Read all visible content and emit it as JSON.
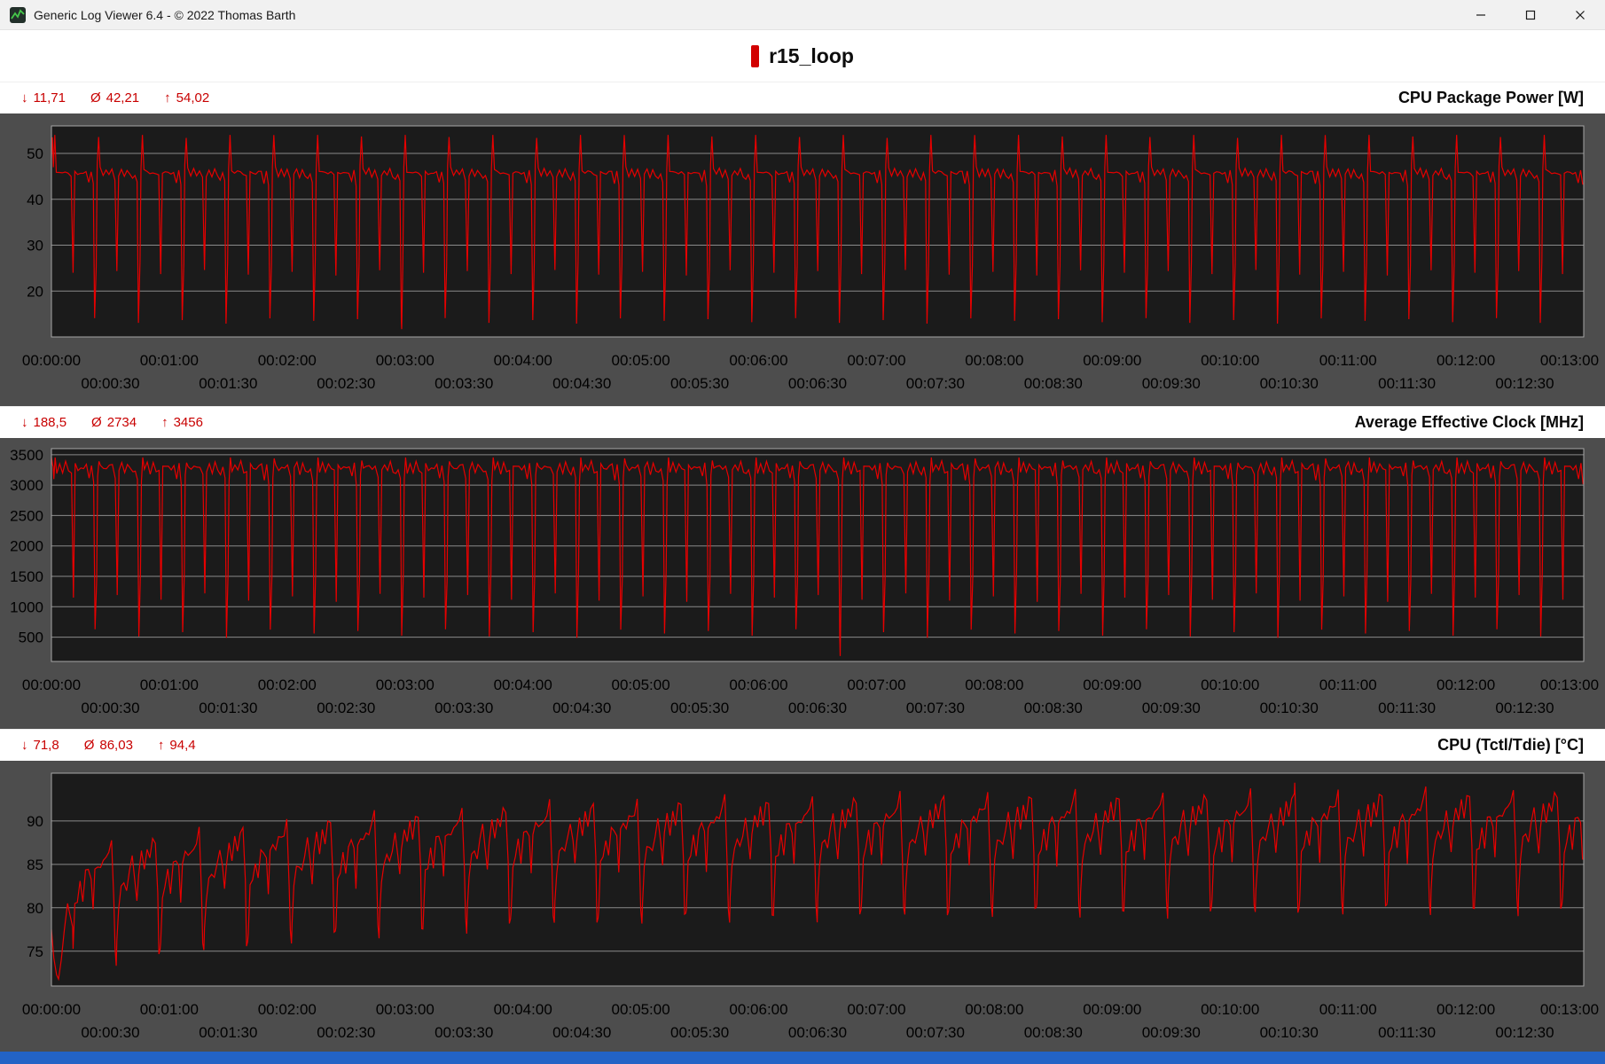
{
  "window": {
    "title": "Generic Log Viewer 6.4 - © 2022 Thomas Barth",
    "controls": [
      "minimize",
      "maximize",
      "close"
    ]
  },
  "header": {
    "title": "r15_loop"
  },
  "glyphs": {
    "min": "↓",
    "avg": "Ø",
    "max": "↑"
  },
  "sections": [
    {
      "title": "CPU Package Power [W]",
      "stats_min": "11,71",
      "stats_avg": "42,21",
      "stats_max": "54,02"
    },
    {
      "title": "Average Effective Clock [MHz]",
      "stats_min": "188,5",
      "stats_avg": "2734",
      "stats_max": "3456"
    },
    {
      "title": "CPU (Tctl/Tdie) [°C]",
      "stats_min": "71,8",
      "stats_avg": "86,03",
      "stats_max": "94,4"
    }
  ],
  "colors": {
    "line": "#e60000",
    "stats_text": "#c80000",
    "accent_bar": "#d20000",
    "block_bg": "#4d4d4d",
    "plot_bg": "#1b1b1b",
    "grid": "#8a8a8a",
    "plot_border": "#a6a6a6",
    "tick_text": "#000000",
    "status_bar": "#2363c5",
    "titlebar_bg": "#f1f1f1"
  },
  "chart_data": [
    {
      "type": "line",
      "title": "CPU Package Power [W]",
      "ylabel": "W",
      "stats": {
        "min": 11.71,
        "avg": 42.21,
        "max": 54.02
      },
      "duration_s": 780,
      "ylim": [
        10,
        56
      ],
      "yticks": [
        20,
        30,
        40,
        50
      ],
      "xticks_row1": [
        "00:00:00",
        "00:01:00",
        "00:02:00",
        "00:03:00",
        "00:04:00",
        "00:05:00",
        "00:06:00",
        "00:07:00",
        "00:08:00",
        "00:09:00",
        "00:10:00",
        "00:11:00",
        "00:12:00",
        "00:13:00"
      ],
      "xticks_row2": [
        "00:00:30",
        "00:01:30",
        "00:02:30",
        "00:03:30",
        "00:04:30",
        "00:05:30",
        "00:06:30",
        "00:07:30",
        "00:08:30",
        "00:09:30",
        "00:10:30",
        "00:11:30",
        "00:12:30"
      ],
      "series": {
        "name": "cpu-package-power",
        "period_s": 22.3,
        "intro_end_s": 1.0,
        "intro_points": [
          [
            0,
            49.0
          ],
          [
            0.5,
            53.5
          ]
        ],
        "cycle_pattern": [
          [
            0.0,
            47.0
          ],
          [
            0.7,
            54.0
          ],
          [
            1.5,
            46.5
          ],
          [
            3.0,
            45.5
          ],
          [
            4.5,
            46.2
          ],
          [
            6.0,
            45.4
          ],
          [
            7.5,
            46.0
          ],
          [
            9.0,
            44.8
          ],
          [
            10.0,
            24.0
          ],
          [
            10.9,
            45.5
          ],
          [
            12.3,
            46.0
          ],
          [
            13.8,
            45.3
          ],
          [
            15.2,
            46.1
          ],
          [
            16.6,
            45.5
          ],
          [
            18.0,
            44.0
          ],
          [
            19.2,
            45.8
          ],
          [
            20.3,
            43.5
          ],
          [
            21.0,
            13.5
          ],
          [
            21.8,
            26.0
          ]
        ],
        "trend": [
          [
            0,
            0
          ],
          [
            780,
            0
          ]
        ],
        "jitter": [
          0,
          1,
          -1,
          0.6,
          -0.7,
          0.9,
          -0.5,
          0.3
        ],
        "jitter_scale": 0.6,
        "extra_points": [
          [
            178.3,
            11.71
          ]
        ]
      }
    },
    {
      "type": "line",
      "title": "Average Effective Clock [MHz]",
      "ylabel": "MHz",
      "stats": {
        "min": 188.5,
        "avg": 2734,
        "max": 3456
      },
      "duration_s": 780,
      "ylim": [
        100,
        3600
      ],
      "yticks": [
        500,
        1000,
        1500,
        2000,
        2500,
        3000,
        3500
      ],
      "xticks_row1": [
        "00:00:00",
        "00:01:00",
        "00:02:00",
        "00:03:00",
        "00:04:00",
        "00:05:00",
        "00:06:00",
        "00:07:00",
        "00:08:00",
        "00:09:00",
        "00:10:00",
        "00:11:00",
        "00:12:00",
        "00:13:00"
      ],
      "xticks_row2": [
        "00:00:30",
        "00:01:30",
        "00:02:30",
        "00:03:30",
        "00:04:30",
        "00:05:30",
        "00:06:30",
        "00:07:30",
        "00:08:30",
        "00:09:30",
        "00:10:30",
        "00:11:30",
        "00:12:30"
      ],
      "series": {
        "name": "average-effective-clock",
        "period_s": 22.3,
        "intro_end_s": 1.2,
        "intro_points": [
          [
            0,
            3456
          ],
          [
            0.5,
            3350
          ],
          [
            0.9,
            3300
          ]
        ],
        "cycle_pattern": [
          [
            0.0,
            3100
          ],
          [
            0.7,
            3440
          ],
          [
            1.5,
            3260
          ],
          [
            3.0,
            3310
          ],
          [
            4.5,
            3250
          ],
          [
            6.0,
            3330
          ],
          [
            7.5,
            3270
          ],
          [
            9.0,
            3180
          ],
          [
            10.0,
            1150
          ],
          [
            10.9,
            3290
          ],
          [
            12.3,
            3310
          ],
          [
            13.8,
            3240
          ],
          [
            15.2,
            3320
          ],
          [
            16.6,
            3280
          ],
          [
            18.0,
            3150
          ],
          [
            19.2,
            3300
          ],
          [
            20.3,
            3050
          ],
          [
            21.0,
            560
          ],
          [
            21.8,
            1500
          ]
        ],
        "trend": [
          [
            0,
            0
          ],
          [
            780,
            0
          ]
        ],
        "jitter": [
          0,
          1,
          -1,
          0.6,
          -0.7,
          0.9,
          -0.5,
          0.3
        ],
        "jitter_scale": 70,
        "extra_points": [
          [
            401.5,
            188.5
          ]
        ]
      }
    },
    {
      "type": "line",
      "title": "CPU (Tctl/Tdie) [°C]",
      "ylabel": "°C",
      "stats": {
        "min": 71.8,
        "avg": 86.03,
        "max": 94.4
      },
      "duration_s": 780,
      "ylim": [
        71,
        95.5
      ],
      "yticks": [
        75,
        80,
        85,
        90
      ],
      "xticks_row1": [
        "00:00:00",
        "00:01:00",
        "00:02:00",
        "00:03:00",
        "00:04:00",
        "00:05:00",
        "00:06:00",
        "00:07:00",
        "00:08:00",
        "00:09:00",
        "00:10:00",
        "00:11:00",
        "00:12:00",
        "00:13:00"
      ],
      "xticks_row2": [
        "00:00:30",
        "00:01:30",
        "00:02:30",
        "00:03:30",
        "00:04:30",
        "00:05:30",
        "00:06:30",
        "00:07:30",
        "00:08:30",
        "00:09:30",
        "00:10:30",
        "00:11:30",
        "00:12:30"
      ],
      "series": {
        "name": "cpu-tctl-tdie",
        "period_s": 22.3,
        "intro_end_s": 11,
        "intro_points": [
          [
            0,
            77.5
          ],
          [
            1.2,
            74.2
          ],
          [
            2.6,
            72.3
          ],
          [
            3.6,
            71.8
          ],
          [
            5.0,
            74.0
          ],
          [
            6.6,
            77.5
          ],
          [
            8.2,
            80.5
          ],
          [
            9.6,
            79.0
          ],
          [
            10.8,
            77.8
          ]
        ],
        "cycle_pattern": [
          [
            0.0,
            81.0
          ],
          [
            0.9,
            85.5
          ],
          [
            2.2,
            87.0
          ],
          [
            3.6,
            88.3
          ],
          [
            5.0,
            86.8
          ],
          [
            6.4,
            89.3
          ],
          [
            7.8,
            90.3
          ],
          [
            9.2,
            88.6
          ],
          [
            10.2,
            85.3
          ],
          [
            11.1,
            89.2
          ],
          [
            12.5,
            90.8
          ],
          [
            14.0,
            89.6
          ],
          [
            15.4,
            91.3
          ],
          [
            16.8,
            90.5
          ],
          [
            18.2,
            92.0
          ],
          [
            19.6,
            92.8
          ],
          [
            20.8,
            86.0
          ],
          [
            21.4,
            79.8
          ],
          [
            22.0,
            79.2
          ]
        ],
        "trend": [
          [
            0,
            -6
          ],
          [
            120,
            -3
          ],
          [
            240,
            -1
          ],
          [
            420,
            0
          ],
          [
            780,
            0.6
          ]
        ],
        "jitter": [
          0,
          1,
          -1,
          0.6,
          -0.7,
          0.9,
          -0.5,
          0.3
        ],
        "jitter_scale": 0.7,
        "extra_points": [
          [
            632.9,
            94.4
          ]
        ]
      }
    }
  ]
}
